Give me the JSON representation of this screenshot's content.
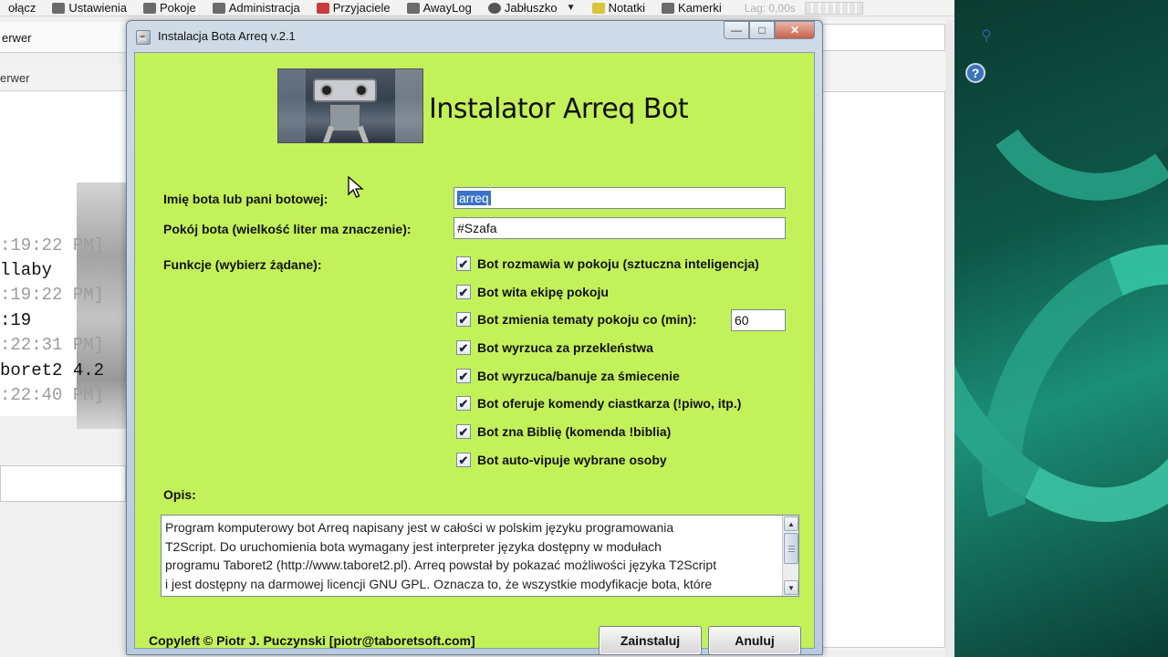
{
  "background_app": {
    "menu": [
      {
        "label": "Połącz",
        "icon": "connect-icon"
      },
      {
        "label": "Ustawienia",
        "icon": "wrench-icon"
      },
      {
        "label": "Pokoje",
        "icon": "rooms-icon"
      },
      {
        "label": "Administracja",
        "icon": "admin-icon"
      },
      {
        "label": "Przyjaciele",
        "icon": "friends-icon"
      },
      {
        "label": "AwayLog",
        "icon": "log-icon"
      },
      {
        "label": "Jabłuszko",
        "icon": "apple-icon"
      },
      {
        "label": "Notatki",
        "icon": "notes-icon"
      },
      {
        "label": "Kamerki",
        "icon": "camera-icon"
      }
    ],
    "menu_display": [
      "ołącz",
      "Ustawienia",
      "Pokoje",
      "Administracja",
      "Przyjaciele",
      "AwayLog",
      "Jabłuszko",
      "Notatki",
      "Kamerki"
    ],
    "lag_label": "Lag: 0,00s",
    "tab_label": "erwer",
    "server_label": "erwer",
    "chat_lines": [
      {
        "text": ":19:22 PM]",
        "kind": "ts"
      },
      {
        "text": "llaby",
        "kind": "msg"
      },
      {
        "text": ":19:22 PM]",
        "kind": "ts"
      },
      {
        "text": ":19",
        "kind": "msg"
      },
      {
        "text": ":22:31 PM]",
        "kind": "ts"
      },
      {
        "text": "boret2 4.2",
        "kind": "msg"
      },
      {
        "text": ":22:40 PM]",
        "kind": "ts"
      }
    ]
  },
  "dialog": {
    "title": "Instalacja Bota Arreq v.2.1",
    "header_title": "Instalator Arreq Bot",
    "name_label": "Imię bota lub pani botowej:",
    "name_value": "arreq",
    "room_label": "Pokój bota (wielkość liter ma znaczenie):",
    "room_value": "#Szafa",
    "functions_label": "Funkcje (wybierz żądane):",
    "features": [
      {
        "label": "Bot rozmawia w pokoju (sztuczna inteligencja)",
        "checked": true
      },
      {
        "label": "Bot wita ekipę pokoju",
        "checked": true
      },
      {
        "label": "Bot zmienia tematy pokoju co (min):",
        "checked": true
      },
      {
        "label": "Bot wyrzuca za przekleństwa",
        "checked": true
      },
      {
        "label": "Bot wyrzuca/banuje za śmiecenie",
        "checked": true
      },
      {
        "label": "Bot oferuje komendy ciastkarza (!piwo, itp.)",
        "checked": true
      },
      {
        "label": "Bot zna Biblię (komenda !biblia)",
        "checked": true
      },
      {
        "label": "Bot auto-vipuje wybrane osoby",
        "checked": true
      }
    ],
    "topic_minutes": "60",
    "description_label": "Opis:",
    "description_lines": [
      "Program komputerowy bot Arreq napisany jest w całości w polskim języku programowania",
      "T2Script. Do uruchomienia bota wymagany jest interpreter języka dostępny w modułach",
      "programu Taboret2 (http://www.taboret2.pl). Arreq powstał by pokazać możliwości języka T2Script",
      "i jest dostępny na darmowej licencji GNU GPL. Oznacza to, że wszystkie modyfikacje bota, które"
    ],
    "copyleft": "Copyleft © Piotr J. Puczynski [piotr@taboretsoft.com]",
    "install_button": "Zainstaluj",
    "cancel_button": "Anuluj"
  },
  "colors": {
    "dialog_client_bg": "#c3f15a",
    "selection": "#3a74c9"
  }
}
